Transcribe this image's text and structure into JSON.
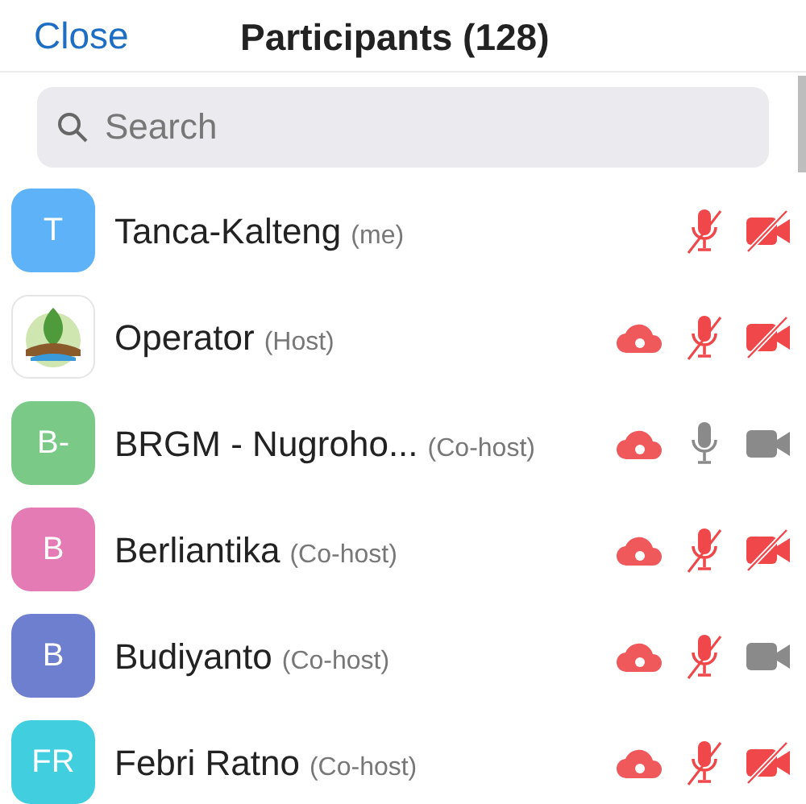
{
  "header": {
    "close": "Close",
    "title": "Participants (128)"
  },
  "search": {
    "placeholder": "Search"
  },
  "participants": [
    {
      "kind": "initials",
      "initials": "T",
      "color": "#5eb2f7",
      "name": "Tanca-Kalteng",
      "role": "(me)",
      "recording": false,
      "mic_muted": true,
      "video_off": true
    },
    {
      "kind": "logo",
      "name": "Operator",
      "role": "(Host)",
      "recording": true,
      "mic_muted": true,
      "video_off": true
    },
    {
      "kind": "initials",
      "initials": "B-",
      "color": "#7bc987",
      "name": "BRGM - Nugroho...",
      "role": "(Co-host)",
      "recording": true,
      "mic_muted": false,
      "video_off": false
    },
    {
      "kind": "initials",
      "initials": "B",
      "color": "#e57bb5",
      "name": "Berliantika",
      "role": "(Co-host)",
      "recording": true,
      "mic_muted": true,
      "video_off": true
    },
    {
      "kind": "initials",
      "initials": "B",
      "color": "#6f7fd0",
      "name": "Budiyanto",
      "role": "(Co-host)",
      "recording": true,
      "mic_muted": true,
      "video_off": false
    },
    {
      "kind": "initials",
      "initials": "FR",
      "color": "#41cfe0",
      "name": "Febri Ratno",
      "role": "(Co-host)",
      "recording": true,
      "mic_muted": true,
      "video_off": true
    }
  ]
}
